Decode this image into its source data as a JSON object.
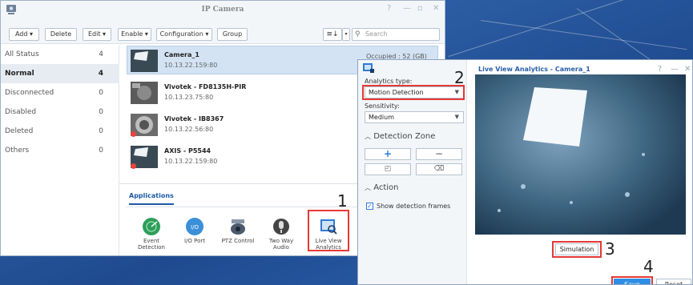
{
  "ip_camera": {
    "title": "IP Camera",
    "toolbar": {
      "add": "Add ▾",
      "delete": "Delete",
      "edit": "Edit ▾",
      "enable": "Enable ▾",
      "configuration": "Configuration ▾",
      "group": "Group",
      "search_placeholder": "Search"
    },
    "sidebar": [
      {
        "label": "All Status",
        "count": "4"
      },
      {
        "label": "Normal",
        "count": "4"
      },
      {
        "label": "Disconnected",
        "count": "0"
      },
      {
        "label": "Disabled",
        "count": "0"
      },
      {
        "label": "Deleted",
        "count": "0"
      },
      {
        "label": "Others",
        "count": "0"
      }
    ],
    "cameras": [
      {
        "name": "Camera_1",
        "ip": "10.13.22.159:80",
        "occupied": "Occupied : 52 (GB)"
      },
      {
        "name": "Vivotek - FD8135H-PIR",
        "ip": "10.13.23.75:80"
      },
      {
        "name": "Vivotek - IB8367",
        "ip": "10.13.22.56:80"
      },
      {
        "name": "AXIS - P5544",
        "ip": "10.13.22.159:80"
      }
    ],
    "applications_tab": "Applications",
    "apps": [
      {
        "label": "Event Detection"
      },
      {
        "label": "I/O Port"
      },
      {
        "label": "PTZ Control"
      },
      {
        "label": "Two Way Audio"
      },
      {
        "label": "Live View Analytics"
      }
    ]
  },
  "lva": {
    "title": "Live View Analytics - Camera_1",
    "analytics_type_label": "Analytics type:",
    "analytics_type_value": "Motion Detection",
    "sensitivity_label": "Sensitivity:",
    "sensitivity_value": "Medium",
    "detection_zone": "Detection Zone",
    "action": "Action",
    "show_frames": "Show detection frames",
    "simulation": "Simulation",
    "save": "Save",
    "reset": "Reset"
  },
  "callouts": [
    "1",
    "2",
    "3",
    "4"
  ],
  "colors": {
    "accent": "#2f8fe6",
    "callout": "#e53935",
    "selected_row": "#d3e3f4"
  }
}
